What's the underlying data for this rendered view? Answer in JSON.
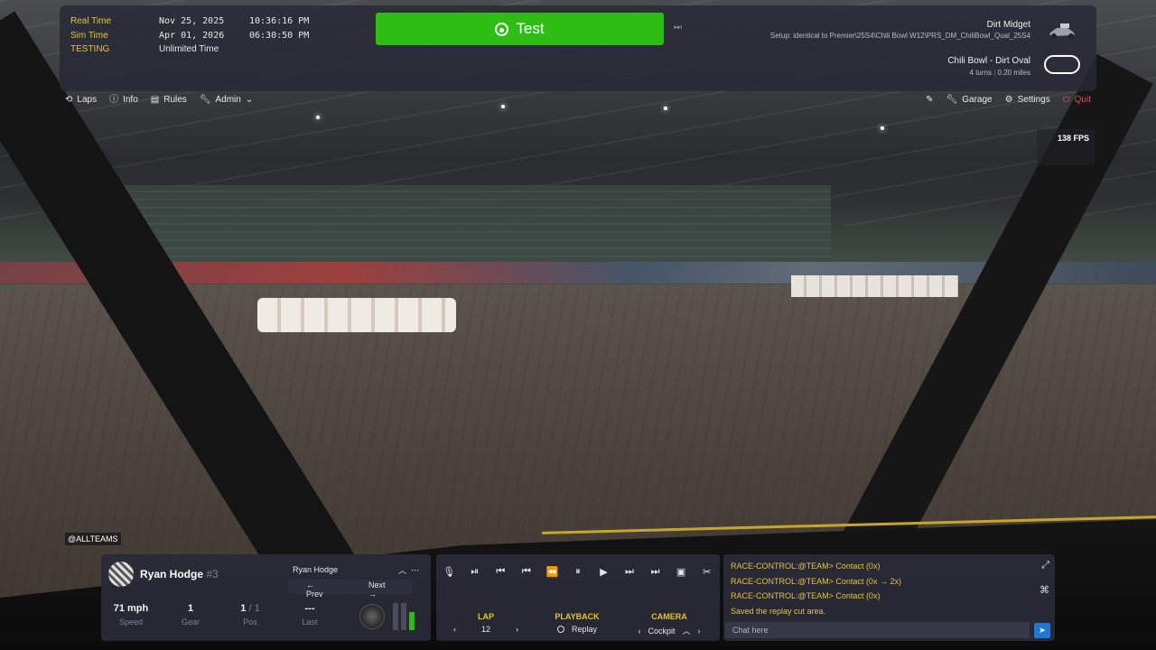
{
  "session": {
    "real_time_label": "Real Time",
    "real_time_date": "Nov 25, 2025",
    "real_time_clock": "10:36:16 PM",
    "sim_time_label": "Sim Time",
    "sim_time_date": "Apr 01, 2026",
    "sim_time_clock": "06:30:50 PM",
    "mode_label": "TESTING",
    "mode_value": "Unlimited Time"
  },
  "test_button": {
    "label": "Test",
    "icon": "steering-wheel-icon"
  },
  "car": {
    "name": "Dirt Midget",
    "setup": "Setup: identical to Premier\\25S4\\Chili Bowl W12\\PRS_DM_ChiliBowl_Qual_25S4"
  },
  "track": {
    "name": "Chili Bowl - Dirt Oval",
    "turns": "4 turns",
    "length": "0.20 miles"
  },
  "nav_left": [
    {
      "label": "Laps",
      "icon": "laps-icon"
    },
    {
      "label": "Info",
      "icon": "info-icon"
    },
    {
      "label": "Rules",
      "icon": "rules-icon"
    },
    {
      "label": "Admin",
      "icon": "wrench-icon"
    }
  ],
  "nav_right": {
    "garage": "Garage",
    "settings": "Settings",
    "quit": "Quit"
  },
  "fps": "138 FPS",
  "overlay_tag": "@ALLTEAMS",
  "driver": {
    "name": "Ryan Hodge",
    "number": "#3",
    "selected": "Ryan Hodge",
    "prev": "← Prev",
    "next": "Next →",
    "speed_value": "71 mph",
    "speed_label": "Speed",
    "gear_value": "1",
    "gear_label": "Gear",
    "pos_value": "1",
    "pos_total": "/ 1",
    "pos_label": "Pos",
    "last_value": "---",
    "last_label": "Last",
    "fuel_level": 0.65
  },
  "replay": {
    "lap_label": "LAP",
    "lap_value": "12",
    "playback_label": "PLAYBACK",
    "playback_value": "Replay",
    "camera_label": "CAMERA",
    "camera_value": "Cockpit"
  },
  "chat": {
    "messages": [
      {
        "sender": "RACE-CONTROL:@TEAM>",
        "text": "Contact (0x)"
      },
      {
        "sender": "RACE-CONTROL:@TEAM>",
        "text": "Contact (0x → 2x)"
      },
      {
        "sender": "RACE-CONTROL:@TEAM>",
        "text": "Contact (0x)"
      },
      {
        "sender": "",
        "text": "Saved the replay cut area."
      }
    ],
    "placeholder": "Chat here"
  },
  "colors": {
    "accent_green": "#2ebd13",
    "label_yellow": "#e7c33a",
    "quit_red": "#e24b4b",
    "send_blue": "#1e78d6"
  }
}
